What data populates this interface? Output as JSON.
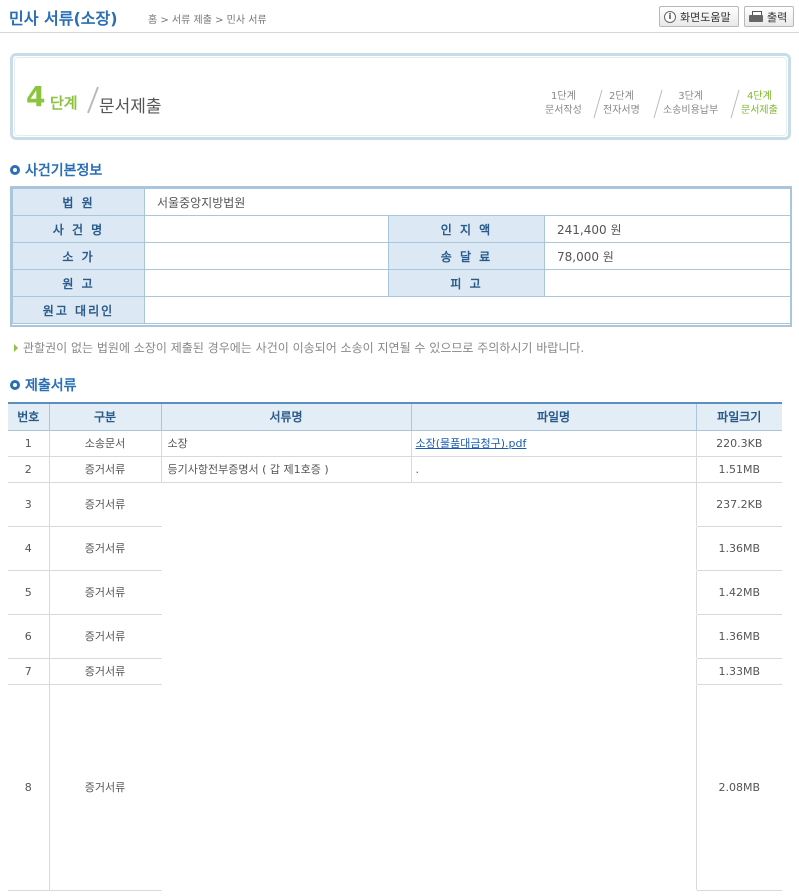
{
  "header": {
    "title": "민사 서류(소장)",
    "breadcrumb": "홈 > 서류 제출 > 민사 서류",
    "help_label": "화면도움말",
    "print_label": "출력"
  },
  "stepbox": {
    "current_num": "4",
    "current_dan": "단계",
    "current_label": "문서제출",
    "steps": [
      {
        "num": "1단계",
        "name": "문서작성"
      },
      {
        "num": "2단계",
        "name": "전자서명"
      },
      {
        "num": "3단계",
        "name": "소송비용납부"
      },
      {
        "num": "4단계",
        "name": "문서제출"
      }
    ]
  },
  "case_info": {
    "section_title": "사건기본정보",
    "court_label": "법 원",
    "court_value": "서울중앙지방법원",
    "case_name_label": "사 건 명",
    "stamp_label": "인 지 액",
    "stamp_value": "241,400 원",
    "claim_label": "소 가",
    "delivery_label": "송 달 료",
    "delivery_value": "78,000 원",
    "plaintiff_label": "원 고",
    "defendant_label": "피 고",
    "agent_label": "원고 대리인"
  },
  "notice": "관할권이 없는 법원에 소장이 제출된 경우에는 사건이 이송되어 소송이 지연될 수 있으므로 주의하시기 바랍니다.",
  "documents": {
    "section_title": "제출서류",
    "headers": [
      "번호",
      "구분",
      "서류명",
      "파일명",
      "파일크기"
    ],
    "rows": [
      {
        "no": "1",
        "type": "소송문서",
        "name": "소장",
        "file": "소장(물품대금청구).pdf",
        "size": "220.3KB"
      },
      {
        "no": "2",
        "type": "증거서류",
        "name": "등기사항전부증명서 ( 갑 제1호증 )",
        "file": ".",
        "size": "1.51MB"
      },
      {
        "no": "3",
        "type": "증거서류",
        "name": "",
        "file": "",
        "size": "237.2KB"
      },
      {
        "no": "4",
        "type": "증거서류",
        "name": "",
        "file": "",
        "size": "1.36MB"
      },
      {
        "no": "5",
        "type": "증거서류",
        "name": "",
        "file": "",
        "size": "1.42MB"
      },
      {
        "no": "6",
        "type": "증거서류",
        "name": "",
        "file": "",
        "size": "1.36MB"
      },
      {
        "no": "7",
        "type": "증거서류",
        "name": "",
        "file": "",
        "size": "1.33MB"
      },
      {
        "no": "8",
        "type": "증거서류",
        "name": "",
        "file": "",
        "size": "2.08MB"
      }
    ]
  },
  "colors": {
    "accent_blue": "#2a6fb6",
    "step_green": "#8cc43f",
    "table_border": "#a9c6dd"
  }
}
